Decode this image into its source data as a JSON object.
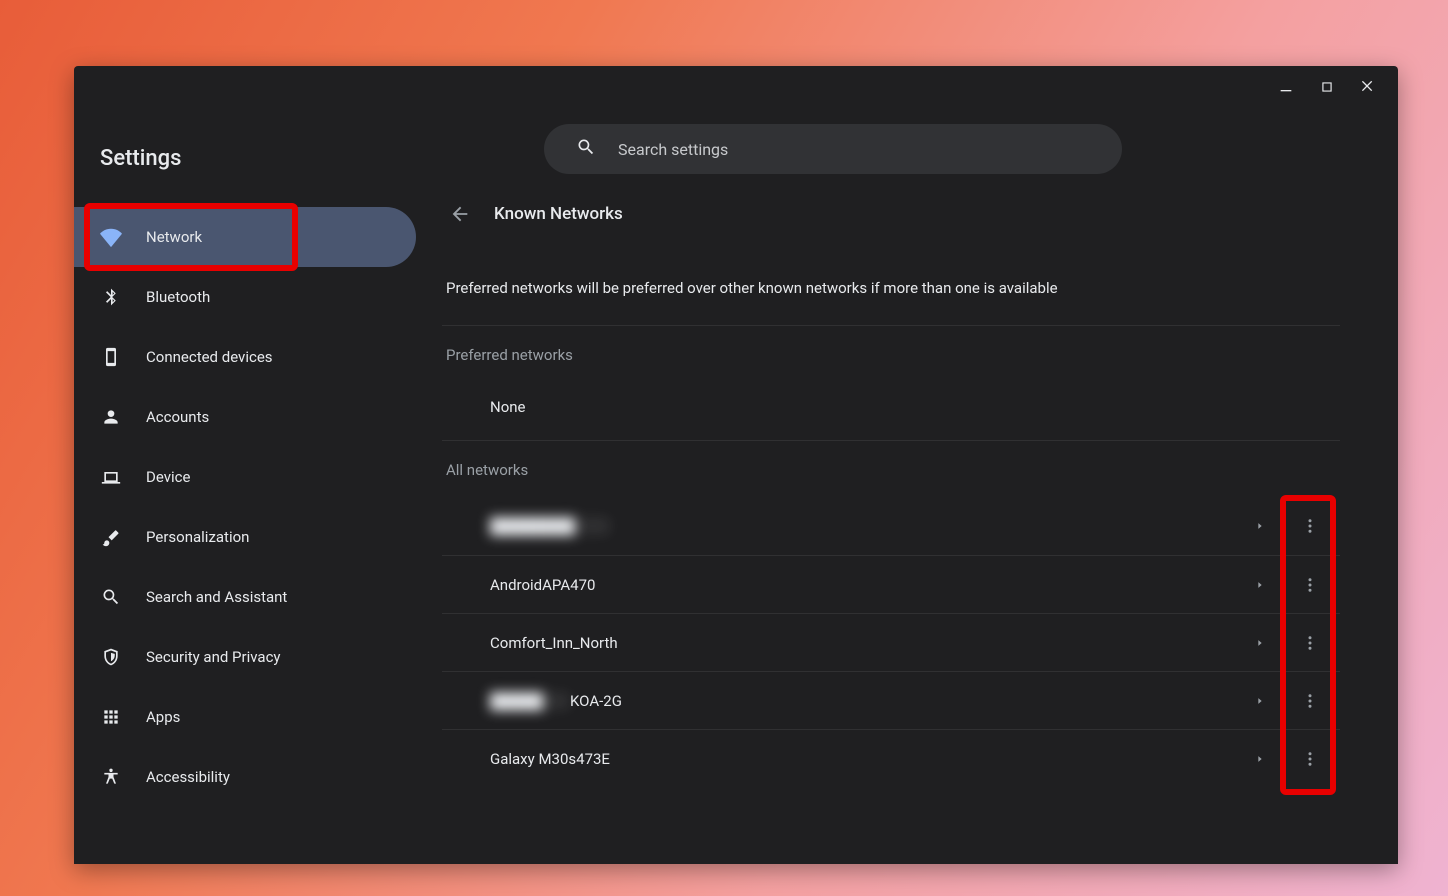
{
  "app_title": "Settings",
  "search": {
    "placeholder": "Search settings"
  },
  "sidebar": {
    "items": [
      {
        "label": "Network",
        "active": true
      },
      {
        "label": "Bluetooth"
      },
      {
        "label": "Connected devices"
      },
      {
        "label": "Accounts"
      },
      {
        "label": "Device"
      },
      {
        "label": "Personalization"
      },
      {
        "label": "Search and Assistant"
      },
      {
        "label": "Security and Privacy"
      },
      {
        "label": "Apps"
      },
      {
        "label": "Accessibility"
      }
    ]
  },
  "panel": {
    "title": "Known Networks",
    "description": "Preferred networks will be preferred over other known networks if more than one is available",
    "preferred_label": "Preferred networks",
    "preferred_none": "None",
    "all_label": "All networks",
    "networks": [
      {
        "name": "",
        "blurred": true,
        "blur_width": 120
      },
      {
        "name": "AndroidAPA470"
      },
      {
        "name": "Comfort_Inn_North"
      },
      {
        "name": "KOA-2G",
        "prefix_blurred": true,
        "blur_width": 80
      },
      {
        "name": "Galaxy M30s473E"
      }
    ]
  }
}
